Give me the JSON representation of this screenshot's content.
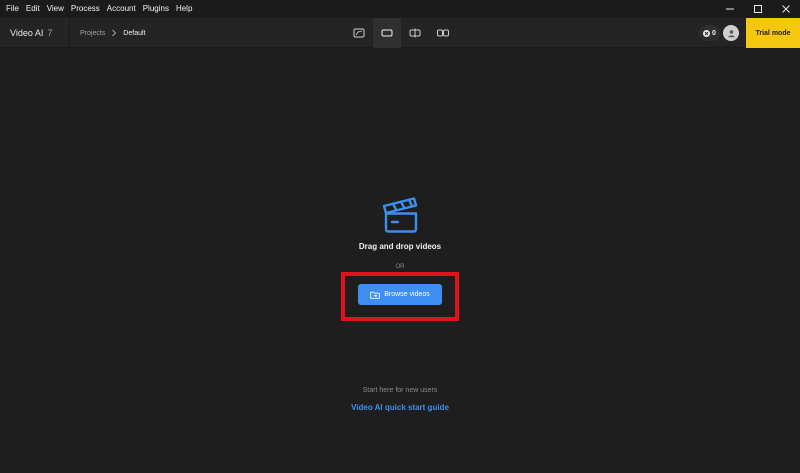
{
  "menubar": {
    "items": [
      "File",
      "Edit",
      "View",
      "Process",
      "Account",
      "Plugins",
      "Help"
    ]
  },
  "window_controls": {
    "minimize_icon": "minimize-icon",
    "maximize_icon": "maximize-icon",
    "close_icon": "close-icon"
  },
  "toolbar": {
    "app_name": "Video AI",
    "app_version": "7",
    "breadcrumb": {
      "parent": "Projects",
      "current": "Default"
    },
    "view_modes": [
      {
        "icon": "single-preview-icon",
        "active": false
      },
      {
        "icon": "full-view-icon",
        "active": true
      },
      {
        "icon": "split-view-icon",
        "active": false
      },
      {
        "icon": "side-by-side-icon",
        "active": false
      }
    ],
    "credits": "0",
    "trial_label": "Trial mode"
  },
  "main": {
    "drop_icon": "clapperboard-icon",
    "drag_text": "Drag and drop videos",
    "or_text": "OR",
    "browse_label": "Browse videos",
    "browse_icon": "folder-icon",
    "start_text": "Start here for new users",
    "guide_link": "Video AI quick start guide"
  },
  "colors": {
    "accent": "#3d8ef0",
    "trial": "#f5c70e",
    "highlight": "#e0121a",
    "background": "#1e1e1e"
  }
}
